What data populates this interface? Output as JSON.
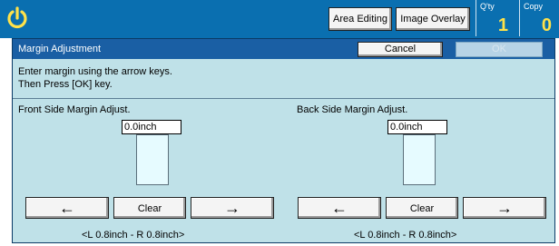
{
  "topbar": {
    "area_editing": "Area Editing",
    "image_overlay": "Image Overlay",
    "qty_label": "Q'ty",
    "qty_value": "1",
    "copy_label": "Copy",
    "copy_value": "0"
  },
  "dialog": {
    "title": "Margin Adjustment",
    "cancel": "Cancel",
    "ok": "OK",
    "instruction_line1": "Enter margin using the arrow keys.",
    "instruction_line2": "Then Press [OK] key."
  },
  "front": {
    "label": "Front Side Margin Adjust.",
    "value": "0.0inch",
    "left_arrow": "←",
    "clear": "Clear",
    "right_arrow": "→",
    "range": "<L 0.8inch - R 0.8inch>"
  },
  "back": {
    "label": "Back Side Margin Adjust.",
    "value": "0.0inch",
    "left_arrow": "←",
    "clear": "Clear",
    "right_arrow": "→",
    "range": "<L 0.8inch - R 0.8inch>"
  },
  "colors": {
    "topbar": "#0a6fb0",
    "panel": "#bfe1e8",
    "title_bar": "#1a5fa4",
    "counter_digits": "#ffe24a"
  }
}
